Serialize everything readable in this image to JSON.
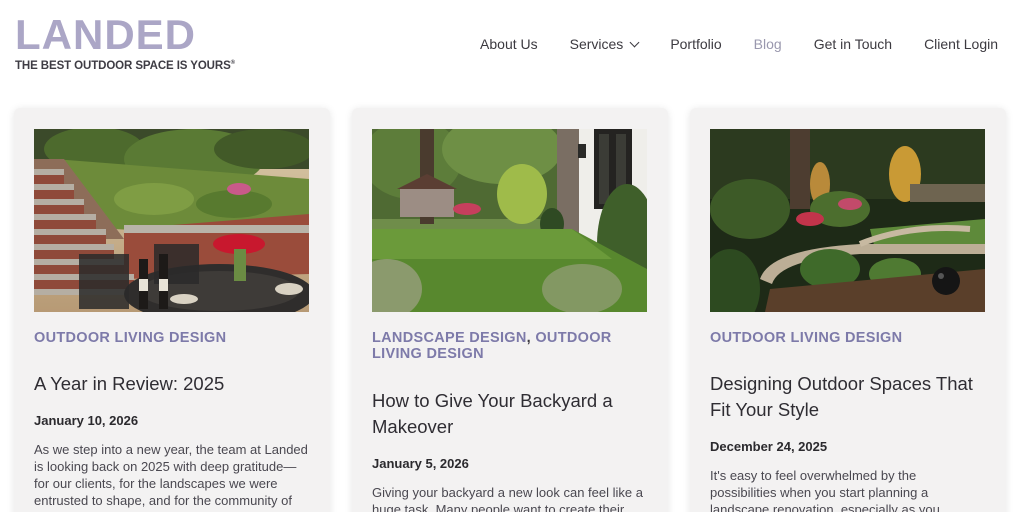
{
  "brand": {
    "name": "LANDED",
    "tagline": "THE BEST OUTDOOR SPACE IS YOURS",
    "trademark": "®",
    "logo_color": "#aba6c6"
  },
  "nav": {
    "items": [
      {
        "label": "About Us"
      },
      {
        "label": "Services",
        "has_dropdown": true
      },
      {
        "label": "Portfolio"
      },
      {
        "label": "Blog",
        "active": true
      },
      {
        "label": "Get in Touch"
      },
      {
        "label": "Client Login"
      }
    ]
  },
  "colors": {
    "category": "#7d7aa9",
    "card_bg": "#f3f2f2",
    "active_nav": "#9a98ae"
  },
  "posts": [
    {
      "categories": [
        "OUTDOOR LIVING DESIGN"
      ],
      "title": "A Year in Review: 2025",
      "date": "January 10, 2026",
      "excerpt": "As we step into a new year, the team at Landed is looking back on 2025 with deep gratitude—for our clients, for the landscapes we were entrusted to shape, and for the community of homeowners",
      "image_icon": "patio-stone-steps-image"
    },
    {
      "categories": [
        "LANDSCAPE DESIGN",
        "OUTDOOR LIVING DESIGN"
      ],
      "category_separator": ",",
      "title": "How to Give Your Backyard a Makeover",
      "date": "January 5, 2026",
      "excerpt": "Giving your backyard a new look can feel like a huge task. Many people want to create their dream back yard but don't",
      "image_icon": "backyard-lawn-image"
    },
    {
      "categories": [
        "OUTDOOR LIVING DESIGN"
      ],
      "title": "Designing Outdoor Spaces That Fit Your Style",
      "date": "December 24, 2025",
      "excerpt": "It's easy to feel overwhelmed by the possibilities when you start planning a landscape renovation, especially as you balance your specific needs with the",
      "image_icon": "night-garden-lighting-image"
    }
  ]
}
